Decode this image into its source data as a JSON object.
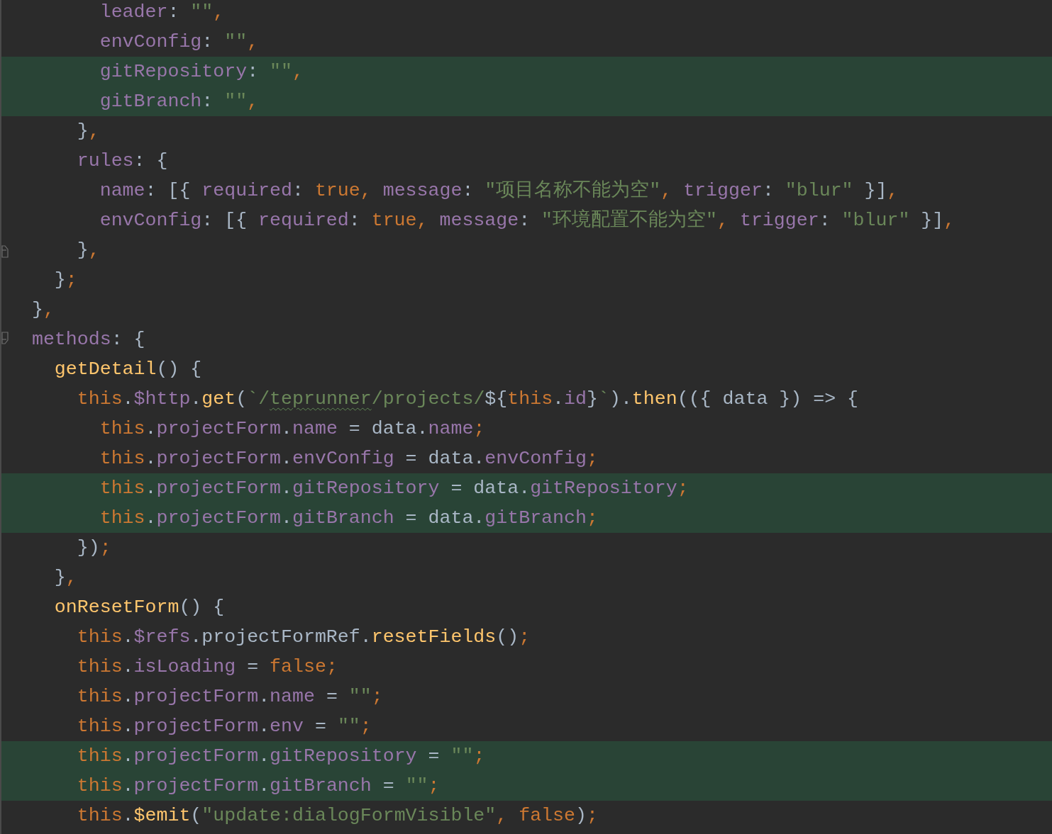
{
  "lines": [
    {
      "highlighted": false,
      "tokens": [
        {
          "kind": "key",
          "text": "        leader"
        },
        {
          "kind": "plain",
          "text": ": "
        },
        {
          "kind": "str",
          "text": "\"\""
        },
        {
          "kind": "kw",
          "text": ","
        }
      ]
    },
    {
      "highlighted": false,
      "tokens": [
        {
          "kind": "key",
          "text": "        envConfig"
        },
        {
          "kind": "plain",
          "text": ": "
        },
        {
          "kind": "str",
          "text": "\"\""
        },
        {
          "kind": "kw",
          "text": ","
        }
      ]
    },
    {
      "highlighted": true,
      "tokens": [
        {
          "kind": "key",
          "text": "        gitRepository"
        },
        {
          "kind": "plain",
          "text": ": "
        },
        {
          "kind": "str",
          "text": "\"\""
        },
        {
          "kind": "kw",
          "text": ","
        }
      ]
    },
    {
      "highlighted": true,
      "tokens": [
        {
          "kind": "key",
          "text": "        gitBranch"
        },
        {
          "kind": "plain",
          "text": ": "
        },
        {
          "kind": "str",
          "text": "\"\""
        },
        {
          "kind": "kw",
          "text": ","
        }
      ]
    },
    {
      "highlighted": false,
      "tokens": [
        {
          "kind": "plain",
          "text": "      }"
        },
        {
          "kind": "kw",
          "text": ","
        }
      ]
    },
    {
      "highlighted": false,
      "tokens": [
        {
          "kind": "key",
          "text": "      rules"
        },
        {
          "kind": "plain",
          "text": ": {"
        }
      ]
    },
    {
      "highlighted": false,
      "tokens": [
        {
          "kind": "key",
          "text": "        name"
        },
        {
          "kind": "plain",
          "text": ": [{ "
        },
        {
          "kind": "key",
          "text": "required"
        },
        {
          "kind": "plain",
          "text": ": "
        },
        {
          "kind": "kw",
          "text": "true, "
        },
        {
          "kind": "key",
          "text": "message"
        },
        {
          "kind": "plain",
          "text": ": "
        },
        {
          "kind": "str",
          "text": "\"项目名称不能为空\""
        },
        {
          "kind": "kw",
          "text": ", "
        },
        {
          "kind": "key",
          "text": "trigger"
        },
        {
          "kind": "plain",
          "text": ": "
        },
        {
          "kind": "str",
          "text": "\"blur\""
        },
        {
          "kind": "plain",
          "text": " }]"
        },
        {
          "kind": "kw",
          "text": ","
        }
      ]
    },
    {
      "highlighted": false,
      "tokens": [
        {
          "kind": "key",
          "text": "        envConfig"
        },
        {
          "kind": "plain",
          "text": ": [{ "
        },
        {
          "kind": "key",
          "text": "required"
        },
        {
          "kind": "plain",
          "text": ": "
        },
        {
          "kind": "kw",
          "text": "true, "
        },
        {
          "kind": "key",
          "text": "message"
        },
        {
          "kind": "plain",
          "text": ": "
        },
        {
          "kind": "str",
          "text": "\"环境配置不能为空\""
        },
        {
          "kind": "kw",
          "text": ", "
        },
        {
          "kind": "key",
          "text": "trigger"
        },
        {
          "kind": "plain",
          "text": ": "
        },
        {
          "kind": "str",
          "text": "\"blur\""
        },
        {
          "kind": "plain",
          "text": " }]"
        },
        {
          "kind": "kw",
          "text": ","
        }
      ]
    },
    {
      "highlighted": false,
      "fold_end": true,
      "tokens": [
        {
          "kind": "plain",
          "text": "      }"
        },
        {
          "kind": "kw",
          "text": ","
        }
      ]
    },
    {
      "highlighted": false,
      "tokens": [
        {
          "kind": "plain",
          "text": "    }"
        },
        {
          "kind": "kw",
          "text": ";"
        }
      ]
    },
    {
      "highlighted": false,
      "tokens": [
        {
          "kind": "plain",
          "text": "  }"
        },
        {
          "kind": "kw",
          "text": ","
        }
      ]
    },
    {
      "highlighted": false,
      "fold_start": true,
      "tokens": [
        {
          "kind": "key",
          "text": "  methods"
        },
        {
          "kind": "plain",
          "text": ": {"
        }
      ]
    },
    {
      "highlighted": false,
      "tokens": [
        {
          "kind": "fn",
          "text": "    getDetail"
        },
        {
          "kind": "plain",
          "text": "() {"
        }
      ]
    },
    {
      "highlighted": false,
      "tokens": [
        {
          "kind": "kw",
          "text": "      this"
        },
        {
          "kind": "plain",
          "text": "."
        },
        {
          "kind": "key",
          "text": "$http"
        },
        {
          "kind": "plain",
          "text": "."
        },
        {
          "kind": "fn",
          "text": "get"
        },
        {
          "kind": "plain",
          "text": "("
        },
        {
          "kind": "str",
          "text": "`/"
        },
        {
          "kind": "typo",
          "text": "teprunner"
        },
        {
          "kind": "str",
          "text": "/projects/"
        },
        {
          "kind": "plain",
          "text": "${"
        },
        {
          "kind": "kw",
          "text": "this"
        },
        {
          "kind": "plain",
          "text": "."
        },
        {
          "kind": "key",
          "text": "id"
        },
        {
          "kind": "plain",
          "text": "}"
        },
        {
          "kind": "str",
          "text": "`"
        },
        {
          "kind": "plain",
          "text": ")."
        },
        {
          "kind": "fn",
          "text": "then"
        },
        {
          "kind": "plain",
          "text": "(({ data }) => {"
        }
      ]
    },
    {
      "highlighted": false,
      "tokens": [
        {
          "kind": "kw",
          "text": "        this"
        },
        {
          "kind": "plain",
          "text": "."
        },
        {
          "kind": "key",
          "text": "projectForm"
        },
        {
          "kind": "plain",
          "text": "."
        },
        {
          "kind": "key",
          "text": "name"
        },
        {
          "kind": "plain",
          "text": " = data."
        },
        {
          "kind": "key",
          "text": "name"
        },
        {
          "kind": "kw",
          "text": ";"
        }
      ]
    },
    {
      "highlighted": false,
      "tokens": [
        {
          "kind": "kw",
          "text": "        this"
        },
        {
          "kind": "plain",
          "text": "."
        },
        {
          "kind": "key",
          "text": "projectForm"
        },
        {
          "kind": "plain",
          "text": "."
        },
        {
          "kind": "key",
          "text": "envConfig"
        },
        {
          "kind": "plain",
          "text": " = data."
        },
        {
          "kind": "key",
          "text": "envConfig"
        },
        {
          "kind": "kw",
          "text": ";"
        }
      ]
    },
    {
      "highlighted": true,
      "tokens": [
        {
          "kind": "kw",
          "text": "        this"
        },
        {
          "kind": "plain",
          "text": "."
        },
        {
          "kind": "key",
          "text": "projectForm"
        },
        {
          "kind": "plain",
          "text": "."
        },
        {
          "kind": "key",
          "text": "gitRepository"
        },
        {
          "kind": "plain",
          "text": " = data."
        },
        {
          "kind": "key",
          "text": "gitRepository"
        },
        {
          "kind": "kw",
          "text": ";"
        }
      ]
    },
    {
      "highlighted": true,
      "tokens": [
        {
          "kind": "kw",
          "text": "        this"
        },
        {
          "kind": "plain",
          "text": "."
        },
        {
          "kind": "key",
          "text": "projectForm"
        },
        {
          "kind": "plain",
          "text": "."
        },
        {
          "kind": "key",
          "text": "gitBranch"
        },
        {
          "kind": "plain",
          "text": " = data."
        },
        {
          "kind": "key",
          "text": "gitBranch"
        },
        {
          "kind": "kw",
          "text": ";"
        }
      ]
    },
    {
      "highlighted": false,
      "tokens": [
        {
          "kind": "plain",
          "text": "      })"
        },
        {
          "kind": "kw",
          "text": ";"
        }
      ]
    },
    {
      "highlighted": false,
      "tokens": [
        {
          "kind": "plain",
          "text": "    }"
        },
        {
          "kind": "kw",
          "text": ","
        }
      ]
    },
    {
      "highlighted": false,
      "tokens": [
        {
          "kind": "fn",
          "text": "    onResetForm"
        },
        {
          "kind": "plain",
          "text": "() {"
        }
      ]
    },
    {
      "highlighted": false,
      "tokens": [
        {
          "kind": "kw",
          "text": "      this"
        },
        {
          "kind": "plain",
          "text": "."
        },
        {
          "kind": "key",
          "text": "$refs"
        },
        {
          "kind": "plain",
          "text": ".projectFormRef."
        },
        {
          "kind": "fn",
          "text": "resetFields"
        },
        {
          "kind": "plain",
          "text": "()"
        },
        {
          "kind": "kw",
          "text": ";"
        }
      ]
    },
    {
      "highlighted": false,
      "tokens": [
        {
          "kind": "kw",
          "text": "      this"
        },
        {
          "kind": "plain",
          "text": "."
        },
        {
          "kind": "key",
          "text": "isLoading"
        },
        {
          "kind": "plain",
          "text": " = "
        },
        {
          "kind": "kw",
          "text": "false;"
        }
      ]
    },
    {
      "highlighted": false,
      "tokens": [
        {
          "kind": "kw",
          "text": "      this"
        },
        {
          "kind": "plain",
          "text": "."
        },
        {
          "kind": "key",
          "text": "projectForm"
        },
        {
          "kind": "plain",
          "text": "."
        },
        {
          "kind": "key",
          "text": "name"
        },
        {
          "kind": "plain",
          "text": " = "
        },
        {
          "kind": "str",
          "text": "\"\""
        },
        {
          "kind": "kw",
          "text": ";"
        }
      ]
    },
    {
      "highlighted": false,
      "tokens": [
        {
          "kind": "kw",
          "text": "      this"
        },
        {
          "kind": "plain",
          "text": "."
        },
        {
          "kind": "key",
          "text": "projectForm"
        },
        {
          "kind": "plain",
          "text": "."
        },
        {
          "kind": "key",
          "text": "env"
        },
        {
          "kind": "plain",
          "text": " = "
        },
        {
          "kind": "str",
          "text": "\"\""
        },
        {
          "kind": "kw",
          "text": ";"
        }
      ]
    },
    {
      "highlighted": true,
      "tokens": [
        {
          "kind": "kw",
          "text": "      this"
        },
        {
          "kind": "plain",
          "text": "."
        },
        {
          "kind": "key",
          "text": "projectForm"
        },
        {
          "kind": "plain",
          "text": "."
        },
        {
          "kind": "key",
          "text": "gitRepository"
        },
        {
          "kind": "plain",
          "text": " = "
        },
        {
          "kind": "str",
          "text": "\"\""
        },
        {
          "kind": "kw",
          "text": ";"
        }
      ]
    },
    {
      "highlighted": true,
      "tokens": [
        {
          "kind": "kw",
          "text": "      this"
        },
        {
          "kind": "plain",
          "text": "."
        },
        {
          "kind": "key",
          "text": "projectForm"
        },
        {
          "kind": "plain",
          "text": "."
        },
        {
          "kind": "key",
          "text": "gitBranch"
        },
        {
          "kind": "plain",
          "text": " = "
        },
        {
          "kind": "str",
          "text": "\"\""
        },
        {
          "kind": "kw",
          "text": ";"
        }
      ]
    },
    {
      "highlighted": false,
      "tokens": [
        {
          "kind": "kw",
          "text": "      this"
        },
        {
          "kind": "plain",
          "text": "."
        },
        {
          "kind": "fn",
          "text": "$emit"
        },
        {
          "kind": "plain",
          "text": "("
        },
        {
          "kind": "str",
          "text": "\"update:dialogFormVisible\""
        },
        {
          "kind": "kw",
          "text": ", false"
        },
        {
          "kind": "plain",
          "text": ")"
        },
        {
          "kind": "kw",
          "text": ";"
        }
      ]
    }
  ]
}
